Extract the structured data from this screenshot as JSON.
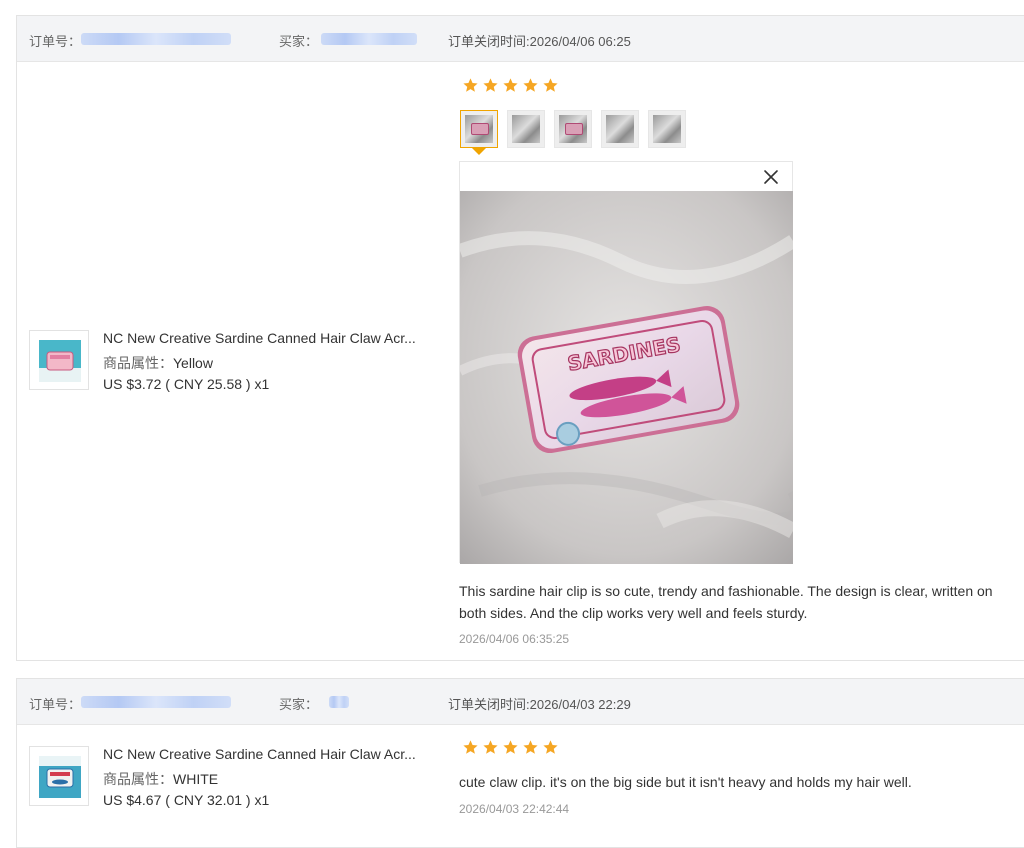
{
  "orders": [
    {
      "order_no_label": "订单号：",
      "buyer_label": "买家：",
      "closed_label": "订单关闭时间:2026/04/06 06:25",
      "product": {
        "title": "NC New Creative Sardine Canned Hair Claw Acr...",
        "attr_key": "商品属性：",
        "attr_val": "Yellow",
        "price": "US $3.72 ( CNY  25.58 ) x1"
      },
      "rating": 5,
      "review_images_count": 5,
      "popup": {
        "photo_text": "SARDINES",
        "close_icon": "close-icon"
      },
      "review": "This sardine hair clip is so cute, trendy and fashionable. The design is clear, written on both sides. And the clip works very well and feels sturdy.",
      "review_date": "2026/04/06 06:35:25"
    },
    {
      "order_no_label": "订单号：",
      "buyer_label": "买家：",
      "closed_label": "订单关闭时间:2026/04/03 22:29",
      "product": {
        "title": "NC New Creative Sardine Canned Hair Claw Acr...",
        "attr_key": "商品属性：",
        "attr_val": "WHITE",
        "price": "US $4.67 ( CNY  32.01 ) x1"
      },
      "rating": 5,
      "review": "cute claw clip. it's on the big side but it isn't heavy and holds my hair well.",
      "review_date": "2026/04/03 22:42:44"
    }
  ],
  "colors": {
    "star": "#f5a623",
    "active_thumb": "#f0a400",
    "header_bg": "#f3f4f6"
  }
}
